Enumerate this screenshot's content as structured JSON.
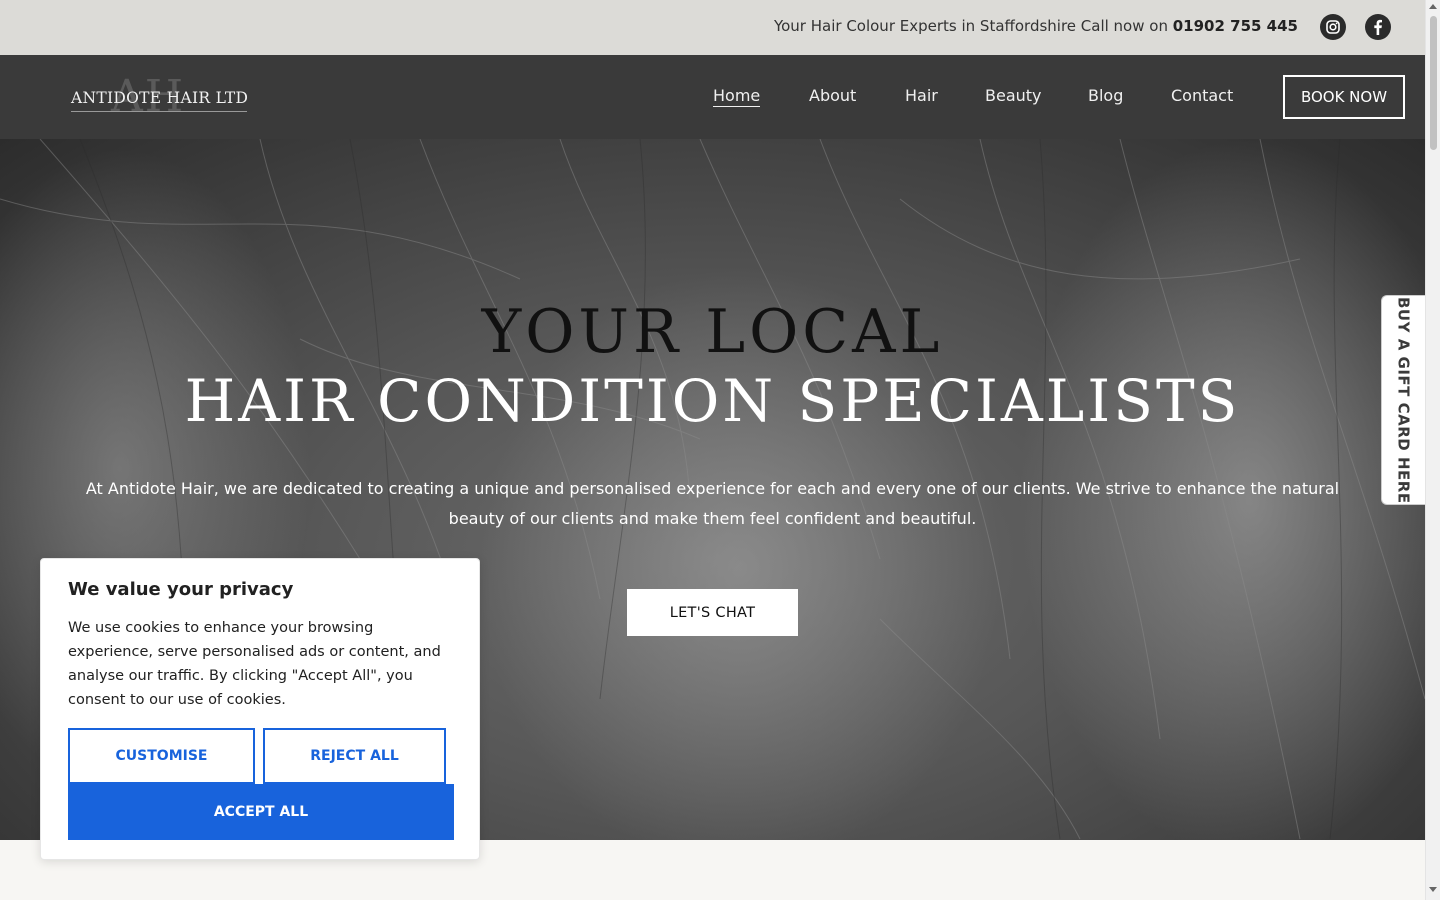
{
  "topbar": {
    "tagline": "Your Hair Colour Experts in Staffordshire Call now on ",
    "phone": "01902 755 445",
    "social": [
      {
        "icon": "instagram-icon"
      },
      {
        "icon": "facebook-icon"
      }
    ]
  },
  "header": {
    "logo_text": "ANTIDOTE HAIR LTD",
    "logo_monogram": "AH",
    "nav": [
      {
        "label": "Home",
        "active": true
      },
      {
        "label": "About"
      },
      {
        "label": "Hair"
      },
      {
        "label": "Beauty"
      },
      {
        "label": "Blog"
      },
      {
        "label": "Contact"
      }
    ],
    "book_label": "BOOK NOW"
  },
  "hero": {
    "title_line1": "YOUR LOCAL",
    "title_line2": "HAIR CONDITION SPECIALISTS",
    "description": "At Antidote Hair, we are dedicated to creating a unique and personalised experience for each and every one of our clients. We strive to enhance the natural beauty of our clients and make them feel confident and beautiful.",
    "cta_label": "LET'S CHAT"
  },
  "gift_tab": {
    "label": "BUY A GIFT CARD HERE"
  },
  "cookie_banner": {
    "title": "We value your privacy",
    "body": "We use cookies to enhance your browsing experience, serve personalised ads or content, and analyse our traffic. By clicking \"Accept All\", you consent to our use of cookies.",
    "customise_label": "CUSTOMISE",
    "reject_label": "REJECT ALL",
    "accept_label": "ACCEPT ALL",
    "accent_color": "#1863dc"
  }
}
